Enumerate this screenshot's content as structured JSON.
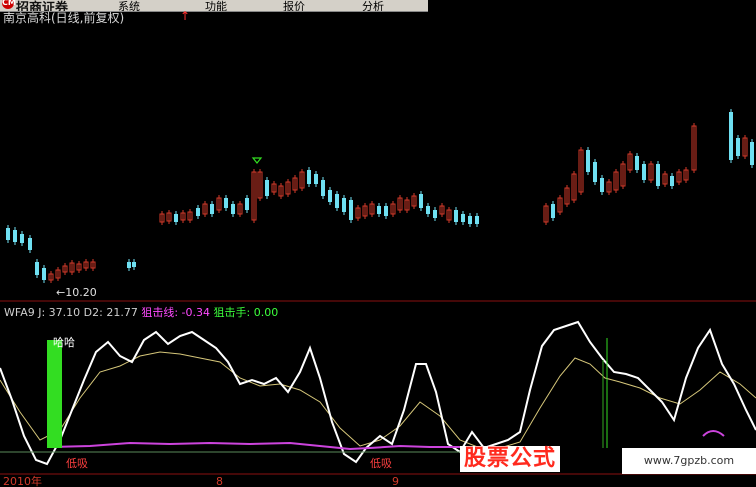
{
  "menubar": {
    "logo_mark": "CM",
    "logo_text": "招商证券",
    "items": [
      "系统",
      "功能",
      "报价",
      "分析"
    ]
  },
  "stock_title": "南京高科(日线,前复权)",
  "title_arrow": "↑",
  "price_label": "←10.20",
  "indicator": {
    "name": "WFA9",
    "j": "J: 37.10",
    "d2": "D2: 21.77",
    "zjx": "狙击线: -0.34",
    "zjs": "狙击手: 0.00"
  },
  "signal_text_1": "哈哈",
  "buy_label": "低吸",
  "axis": {
    "year": "2010年",
    "m1": "8",
    "m2": "9"
  },
  "watermark": {
    "logo": "股票公式",
    "url": "www.7gpzb.com"
  },
  "colors": {
    "up": "#d23a2a",
    "down": "#6fe0f2",
    "j_line": "#ffffff",
    "d_line": "#d6c77a",
    "magenta": "#cc44dd",
    "signal_green": "#33dd22"
  }
}
